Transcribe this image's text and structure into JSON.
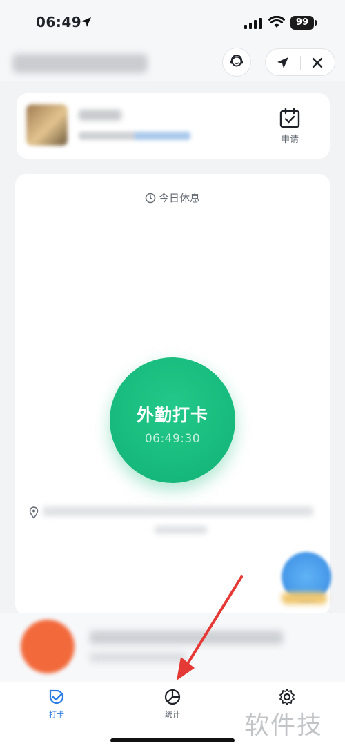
{
  "status_bar": {
    "time": "06:49",
    "battery": "99"
  },
  "rest": {
    "label": "今日休息"
  },
  "apply": {
    "label": "申请"
  },
  "checkin": {
    "label": "外勤打卡",
    "time": "06:49:30"
  },
  "tabs": [
    {
      "label": "打卡",
      "active": true
    },
    {
      "label": "统计",
      "active": false
    }
  ],
  "watermark": "软件技巧",
  "colors": {
    "accent_green": "#15b87a",
    "tab_active_blue": "#2a7be4",
    "arrow_red": "#e53935"
  }
}
